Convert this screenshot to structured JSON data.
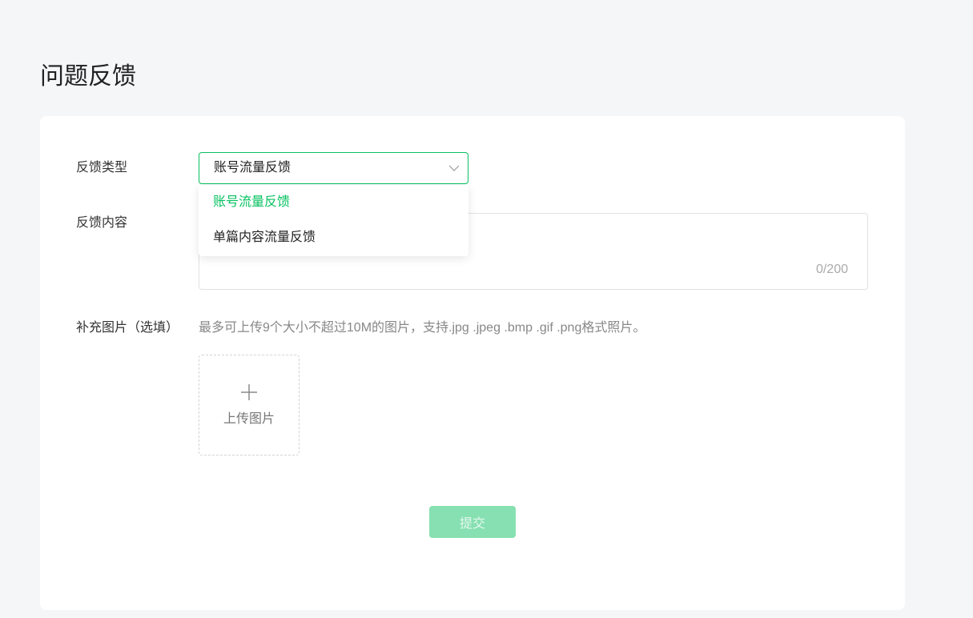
{
  "colors": {
    "page_background": "#f5f6f8",
    "accent": "#07c160",
    "submit_disabled": "#86e0b1"
  },
  "icons": {
    "select_arrow": "chevron-down-icon",
    "upload": "plus-icon"
  },
  "page": {
    "title": "问题反馈"
  },
  "form": {
    "feedback_type": {
      "label": "反馈类型",
      "selected": "账号流量反馈",
      "options": [
        "账号流量反馈",
        "单篇内容流量反馈"
      ]
    },
    "feedback_content": {
      "label": "反馈内容",
      "char_count": "0/200"
    },
    "images": {
      "label": "补充图片（选填）",
      "hint": "最多可上传9个大小不超过10M的图片，支持.jpg .jpeg .bmp .gif .png格式照片。",
      "upload_label": "上传图片"
    },
    "submit_label": "提交"
  }
}
